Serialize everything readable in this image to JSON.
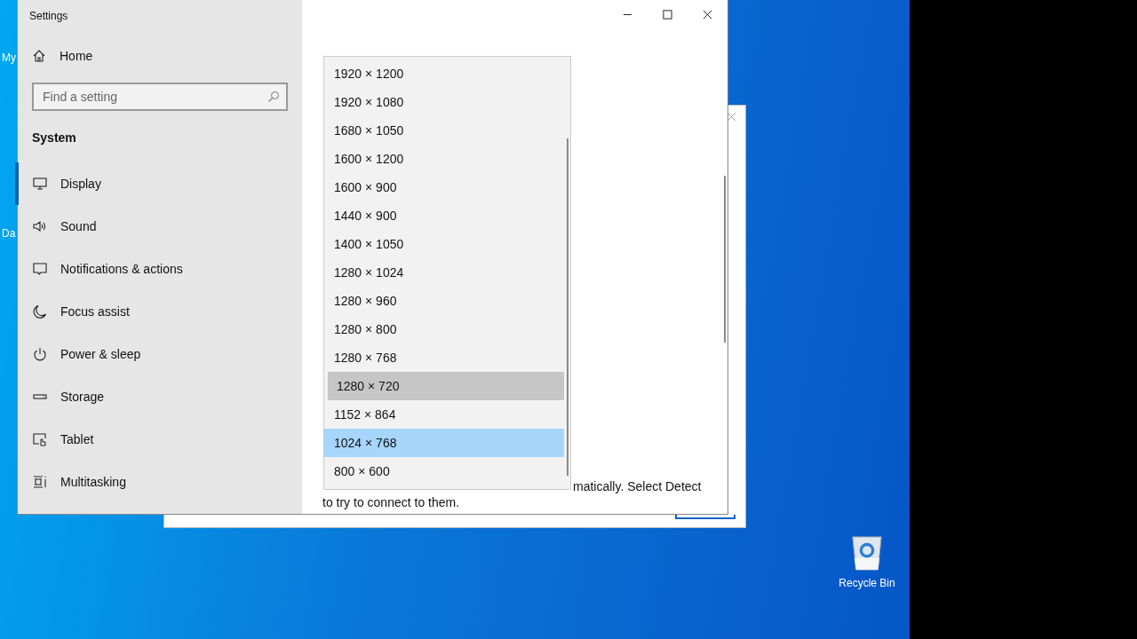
{
  "desktop": {
    "icon_labels": [
      "My",
      "Da"
    ],
    "recycle_bin": {
      "label": "Recycle Bin"
    }
  },
  "window": {
    "title": "Settings"
  },
  "sidebar": {
    "home": "Home",
    "search": {
      "placeholder": "Find a setting"
    },
    "section": "System",
    "items": [
      {
        "label": "Display",
        "selected": true
      },
      {
        "label": "Sound",
        "selected": false
      },
      {
        "label": "Notifications & actions",
        "selected": false
      },
      {
        "label": "Focus assist",
        "selected": false
      },
      {
        "label": "Power & sleep",
        "selected": false
      },
      {
        "label": "Storage",
        "selected": false
      },
      {
        "label": "Tablet",
        "selected": false
      },
      {
        "label": "Multitasking",
        "selected": false
      }
    ]
  },
  "dropdown": {
    "options": [
      {
        "label": "1920 × 1200",
        "selected": false,
        "hovered": false
      },
      {
        "label": "1920 × 1080",
        "selected": false,
        "hovered": false
      },
      {
        "label": "1680 × 1050",
        "selected": false,
        "hovered": false
      },
      {
        "label": "1600 × 1200",
        "selected": false,
        "hovered": false
      },
      {
        "label": "1600 × 900",
        "selected": false,
        "hovered": false
      },
      {
        "label": "1440 × 900",
        "selected": false,
        "hovered": false
      },
      {
        "label": "1400 × 1050",
        "selected": false,
        "hovered": false
      },
      {
        "label": "1280 × 1024",
        "selected": false,
        "hovered": false
      },
      {
        "label": "1280 × 960",
        "selected": false,
        "hovered": false
      },
      {
        "label": "1280 × 800",
        "selected": false,
        "hovered": false
      },
      {
        "label": "1280 × 768",
        "selected": false,
        "hovered": false
      },
      {
        "label": "1280 × 720",
        "selected": false,
        "hovered": true
      },
      {
        "label": "1152 × 864",
        "selected": false,
        "hovered": false
      },
      {
        "label": "1024 × 768",
        "selected": true,
        "hovered": false
      },
      {
        "label": "800 × 600",
        "selected": false,
        "hovered": false
      }
    ]
  },
  "content": {
    "text_lines": [
      "matically. Select Detect",
      "to try to connect to them."
    ]
  }
}
